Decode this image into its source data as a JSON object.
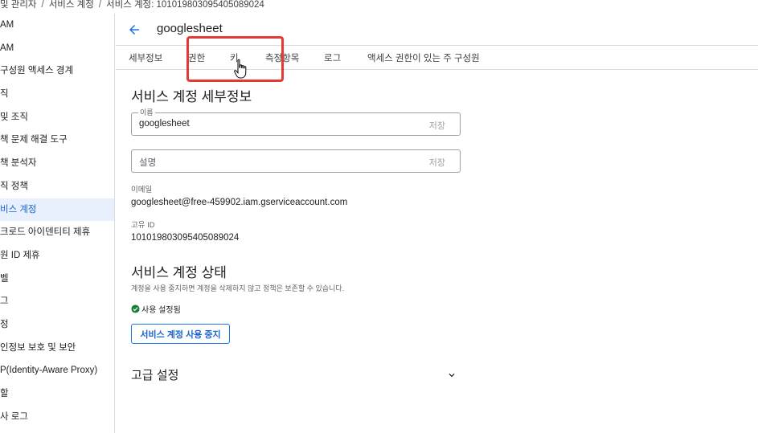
{
  "breadcrumb": {
    "items": [
      "및 관리자",
      "서비스 계정",
      "서비스 계정: 101019803095405089024"
    ],
    "separator": "/"
  },
  "sidebar": {
    "items": [
      {
        "label": "AM",
        "active": false
      },
      {
        "label": "AM",
        "active": false
      },
      {
        "label": "구성원 액세스 경계",
        "active": false
      },
      {
        "label": "직",
        "active": false
      },
      {
        "label": "및 조직",
        "active": false
      },
      {
        "label": "책 문제 해결 도구",
        "active": false
      },
      {
        "label": "책 분석자",
        "active": false
      },
      {
        "label": "직 정책",
        "active": false
      },
      {
        "label": "비스 계정",
        "active": true
      },
      {
        "label": "크로드 아이덴티티 제휴",
        "active": false
      },
      {
        "label": "원 ID 제휴",
        "active": false
      },
      {
        "label": "벨",
        "active": false
      },
      {
        "label": "그",
        "active": false
      },
      {
        "label": "정",
        "active": false
      },
      {
        "label": "인정보 보호 및 보안",
        "active": false
      },
      {
        "label": "P(Identity-Aware Proxy)",
        "active": false
      },
      {
        "label": "할",
        "active": false
      },
      {
        "label": "사 로그",
        "active": false
      }
    ]
  },
  "header": {
    "title": "googlesheet",
    "back_icon": "arrow-back-icon"
  },
  "tabs": [
    {
      "label": "세부정보"
    },
    {
      "label": "권한"
    },
    {
      "label": "키"
    },
    {
      "label": "측정항목"
    },
    {
      "label": "로그"
    },
    {
      "label": "액세스 권한이 있는 주 구성원"
    }
  ],
  "details": {
    "section_title": "서비스 계정 세부정보",
    "name_field": {
      "label": "이름",
      "value": "googlesheet",
      "action": "저장"
    },
    "description_field": {
      "placeholder": "설명",
      "action": "저장"
    },
    "email_label": "이메일",
    "email_value": "googlesheet@free-459902.iam.gserviceaccount.com",
    "uid_label": "고유 ID",
    "uid_value": "101019803095405089024"
  },
  "status": {
    "section_title": "서비스 계정 상태",
    "description": "계정을 사용 중지하면 계정을 삭제하지 않고 정책은 보존할 수 있습니다.",
    "state_text": "사용 설정됨",
    "state_icon": "check-circle-icon",
    "disable_button": "서비스 계정 사용 중지"
  },
  "advanced": {
    "title": "고급 설정",
    "toggle_icon": "chevron-down-icon"
  },
  "colors": {
    "accent": "#1a73e8",
    "active_bg": "#e8f0fe",
    "highlight": "#e53935",
    "success": "#188038"
  }
}
